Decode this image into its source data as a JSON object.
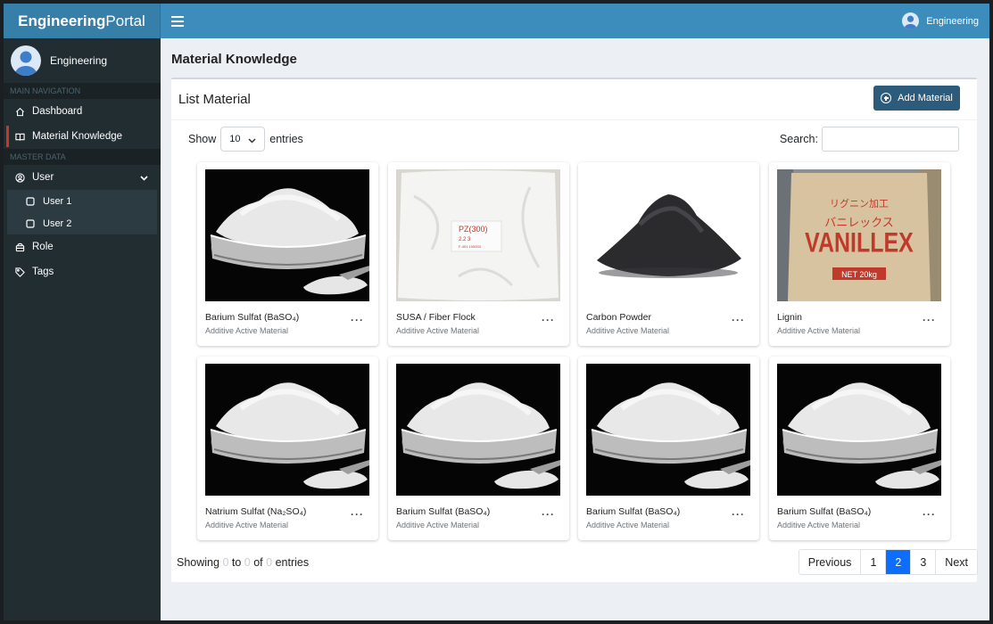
{
  "brand": {
    "bold": "Engineering",
    "light": "Portal"
  },
  "user": {
    "name": "Engineering"
  },
  "sidebar": {
    "main_header": "MAIN NAVIGATION",
    "master_header": "MASTER DATA",
    "items": {
      "dashboard": "Dashboard",
      "material": "Material Knowledge",
      "user": "User",
      "user1": "User 1",
      "user2": "User 2",
      "role": "Role",
      "tags": "Tags"
    }
  },
  "page": {
    "title": "Material Knowledge"
  },
  "box": {
    "title": "List Material",
    "add_label": "Add Material"
  },
  "table_controls": {
    "show_label": "Show",
    "page_size": "10",
    "entries_label": "entries",
    "search_label": "Search:",
    "search_value": ""
  },
  "cards": [
    {
      "name": "Barium Sulfat (BaSO₄)",
      "category": "Additive Active Material",
      "image": "white-powder-dish"
    },
    {
      "name": "SUSA / Fiber Flock",
      "category": "Additive Active Material",
      "image": "white-sack"
    },
    {
      "name": "Carbon Powder",
      "category": "Additive Active Material",
      "image": "black-powder"
    },
    {
      "name": "Lignin",
      "category": "Additive Active Material",
      "image": "vanillex-bag",
      "bag_label": "VANILLEX",
      "bag_jp": "リグニン加工",
      "bag_sub": "バニレックス",
      "bag_net": "NET 20kg"
    },
    {
      "name": "Natrium Sulfat (Na₂SO₄)",
      "category": "Additive Active Material",
      "image": "white-powder-dish"
    },
    {
      "name": "Barium Sulfat (BaSO₄)",
      "category": "Additive Active Material",
      "image": "white-powder-dish"
    },
    {
      "name": "Barium Sulfat (BaSO₄)",
      "category": "Additive Active Material",
      "image": "white-powder-dish"
    },
    {
      "name": "Barium Sulfat (BaSO₄)",
      "category": "Additive Active Material",
      "image": "white-powder-dish"
    }
  ],
  "more_label": "···",
  "info": {
    "prefix": "Showing",
    "from": "0",
    "to_label": "to",
    "to": "0",
    "of_label": "of",
    "total": "0",
    "suffix": "entries"
  },
  "pagination": {
    "previous": "Previous",
    "pages": [
      "1",
      "2",
      "3"
    ],
    "active": "2",
    "next": "Next"
  },
  "colors": {
    "topbar": "#3c8dbc",
    "brand": "#367fa9",
    "sidebar": "#222d32",
    "add_button": "#2d5b7b",
    "active_page": "#0d6efd",
    "active_marker": "#c0392b"
  }
}
